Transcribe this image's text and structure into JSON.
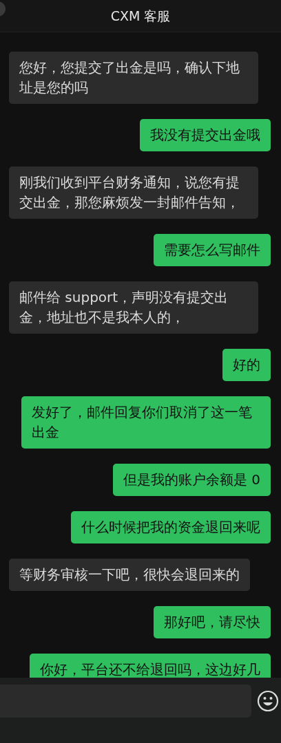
{
  "header": {
    "title": "CXM 客服"
  },
  "messages": [
    {
      "kind": "incoming",
      "text": "您好，您提交了出金是吗，确认下地址是您的吗"
    },
    {
      "kind": "outgoing",
      "text": "我没有提交出金哦"
    },
    {
      "kind": "incoming",
      "text": "刚我们收到平台财务通知，说您有提交出金，那您麻烦发一封邮件告知，"
    },
    {
      "kind": "outgoing",
      "text": "需要怎么写邮件"
    },
    {
      "kind": "incoming",
      "text": "邮件给 support，声明没有提交出金，地址也不是我本人的，"
    },
    {
      "kind": "outgoing",
      "text": "好的"
    },
    {
      "kind": "outgoing",
      "text": "发好了，邮件回复你们取消了这一笔出金"
    },
    {
      "kind": "outgoing",
      "text": "但是我的账户余额是 0"
    },
    {
      "kind": "outgoing",
      "text": "什么时候把我的资金退回来呢"
    },
    {
      "kind": "incoming",
      "text": "等财务审核一下吧，很快会退回来的"
    },
    {
      "kind": "outgoing",
      "text": "那好吧，请尽快"
    },
    {
      "kind": "outgoing",
      "text": "你好，平台还不给退回吗，这边好几"
    }
  ]
}
